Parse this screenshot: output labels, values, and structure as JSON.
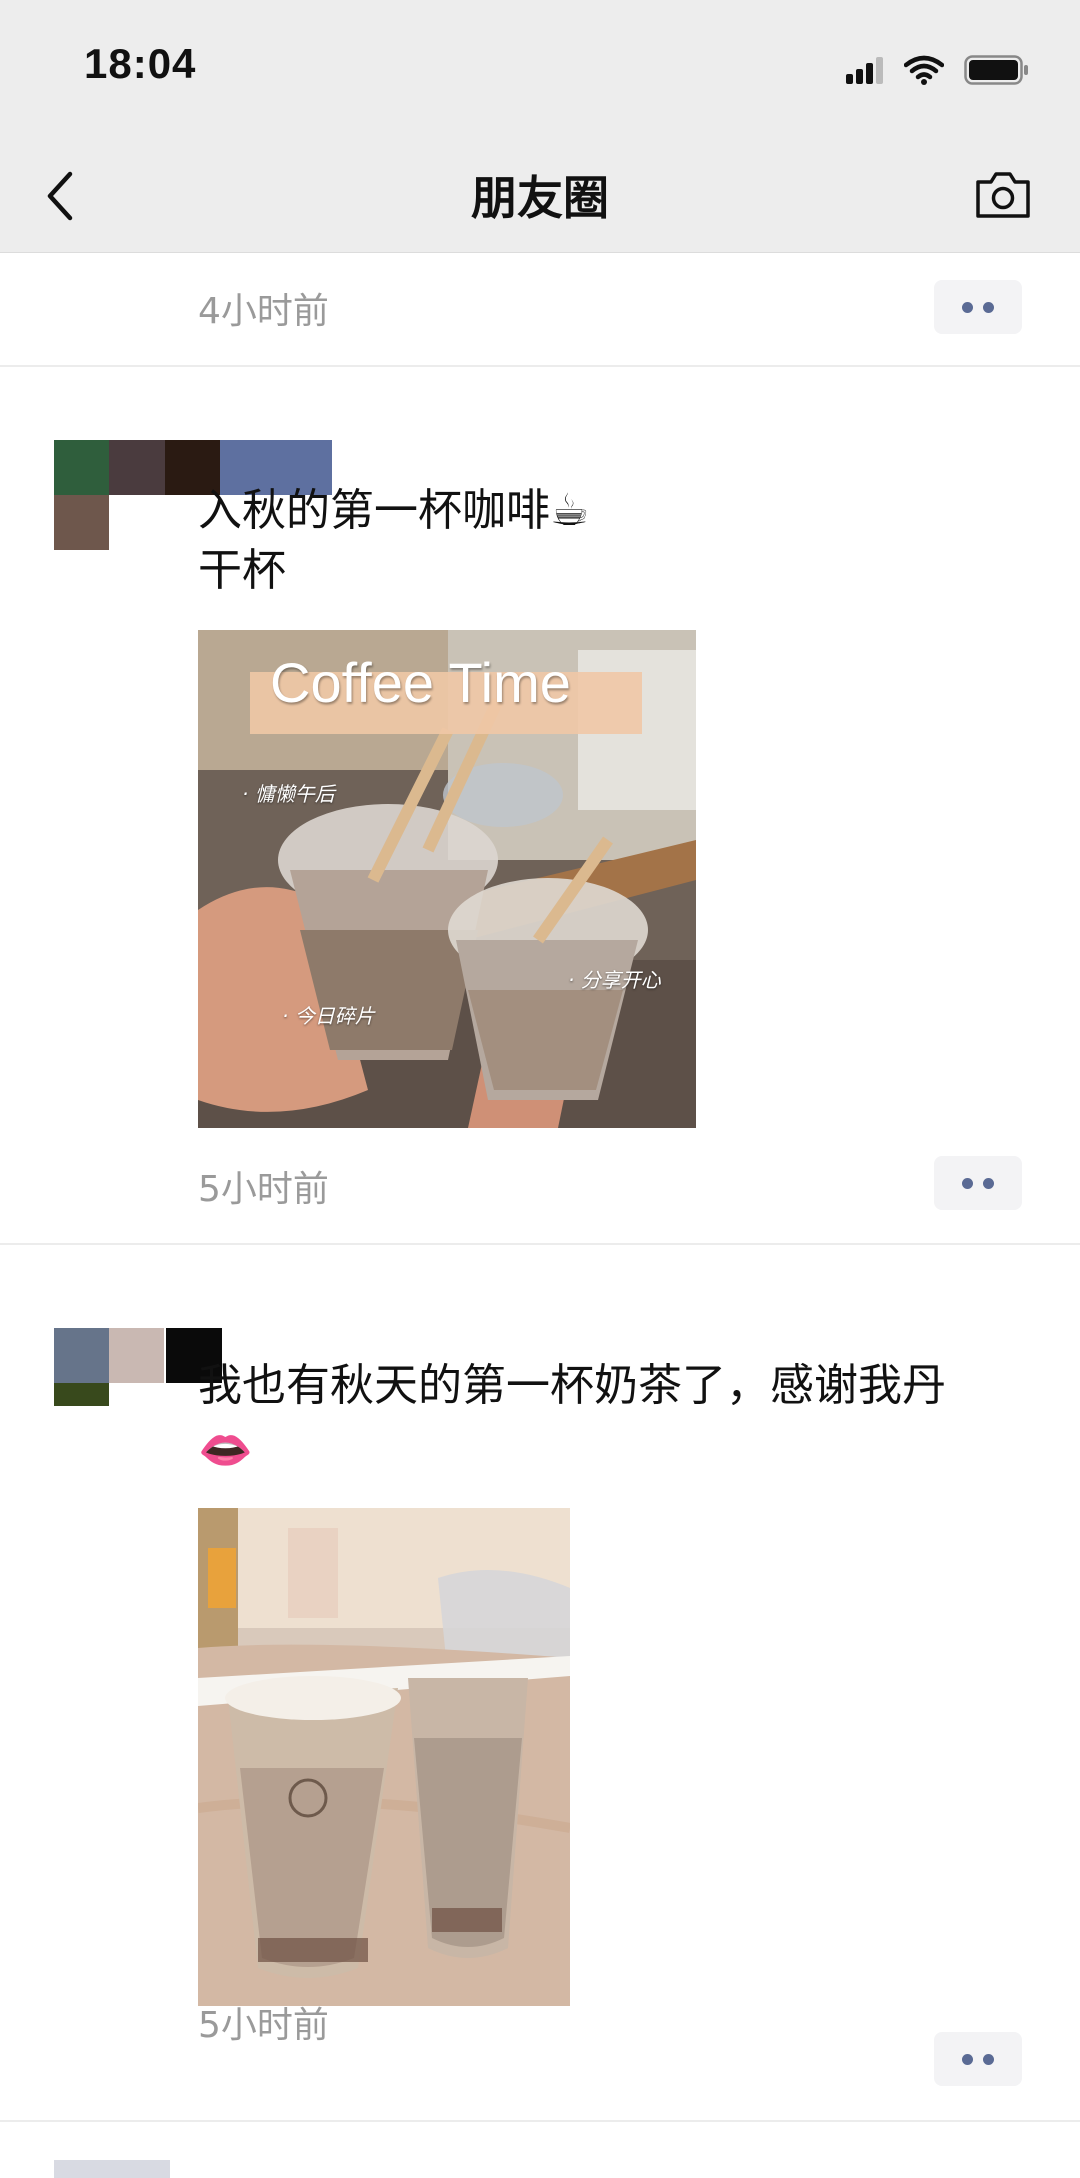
{
  "status_bar": {
    "time": "18:04"
  },
  "nav": {
    "title": "朋友圈"
  },
  "posts": [
    {
      "time": "4小时前"
    },
    {
      "text_line1": "入秋的第一杯咖啡☕",
      "text_line2": " 干杯",
      "photo": {
        "title": "Coffee Time",
        "label_1": "· 慵懒午后",
        "label_2": "· 今日碎片",
        "label_3": "· 分享开心"
      },
      "time": "5小时前"
    },
    {
      "text_line1": "我也有秋天的第一杯奶茶了，感谢我丹",
      "text_line2": "👄",
      "time": "5小时前"
    }
  ],
  "colors": {
    "nav_bg": "#ededed",
    "meta_text": "#9a9a9a",
    "more_dots": "#5a6a94",
    "more_bg": "#f3f3f5"
  },
  "icons": [
    "back-icon",
    "camera-icon",
    "signal-icon",
    "wifi-icon",
    "battery-icon",
    "more-icon"
  ]
}
